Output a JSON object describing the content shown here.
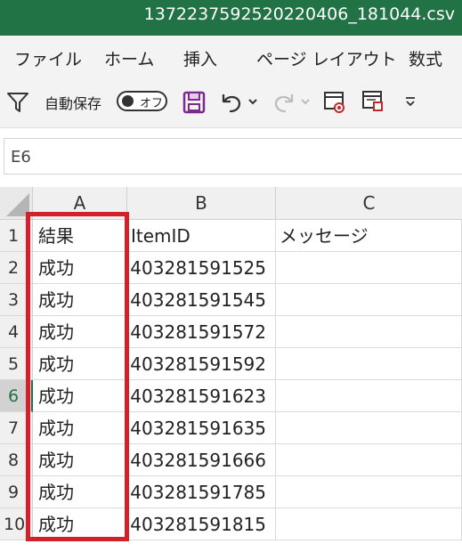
{
  "window": {
    "title": "1372237592520220406_181044.csv"
  },
  "menu": {
    "items": [
      {
        "label": "ファイル"
      },
      {
        "label": "ホーム"
      },
      {
        "label": "挿入"
      },
      {
        "label": "ページ レイアウト"
      },
      {
        "label": "数式"
      }
    ]
  },
  "toolbar": {
    "autosave_label": "自動保存",
    "autosave_state": "オフ",
    "icons": [
      "filter-icon",
      "save-icon",
      "undo-icon",
      "redo-icon",
      "print-preview-icon",
      "print-area-icon",
      "customize-toolbar-icon"
    ]
  },
  "namebox": {
    "value": "E6"
  },
  "sheet": {
    "columns": [
      "A",
      "B",
      "C"
    ],
    "active_row": "6",
    "rows": [
      {
        "num": "1",
        "a": "結果",
        "b": "ItemID",
        "c": "メッセージ"
      },
      {
        "num": "2",
        "a": "成功",
        "b": "403281591525",
        "c": ""
      },
      {
        "num": "3",
        "a": "成功",
        "b": "403281591545",
        "c": ""
      },
      {
        "num": "4",
        "a": "成功",
        "b": "403281591572",
        "c": ""
      },
      {
        "num": "5",
        "a": "成功",
        "b": "403281591592",
        "c": ""
      },
      {
        "num": "6",
        "a": "成功",
        "b": "403281591623",
        "c": ""
      },
      {
        "num": "7",
        "a": "成功",
        "b": "403281591635",
        "c": ""
      },
      {
        "num": "8",
        "a": "成功",
        "b": "403281591666",
        "c": ""
      },
      {
        "num": "9",
        "a": "成功",
        "b": "403281591785",
        "c": ""
      },
      {
        "num": "10",
        "a": "成功",
        "b": "403281591815",
        "c": ""
      }
    ]
  },
  "colors": {
    "title_bar": "#217346",
    "highlight_box": "#d4202a",
    "save_icon": "#7b2b8e"
  }
}
